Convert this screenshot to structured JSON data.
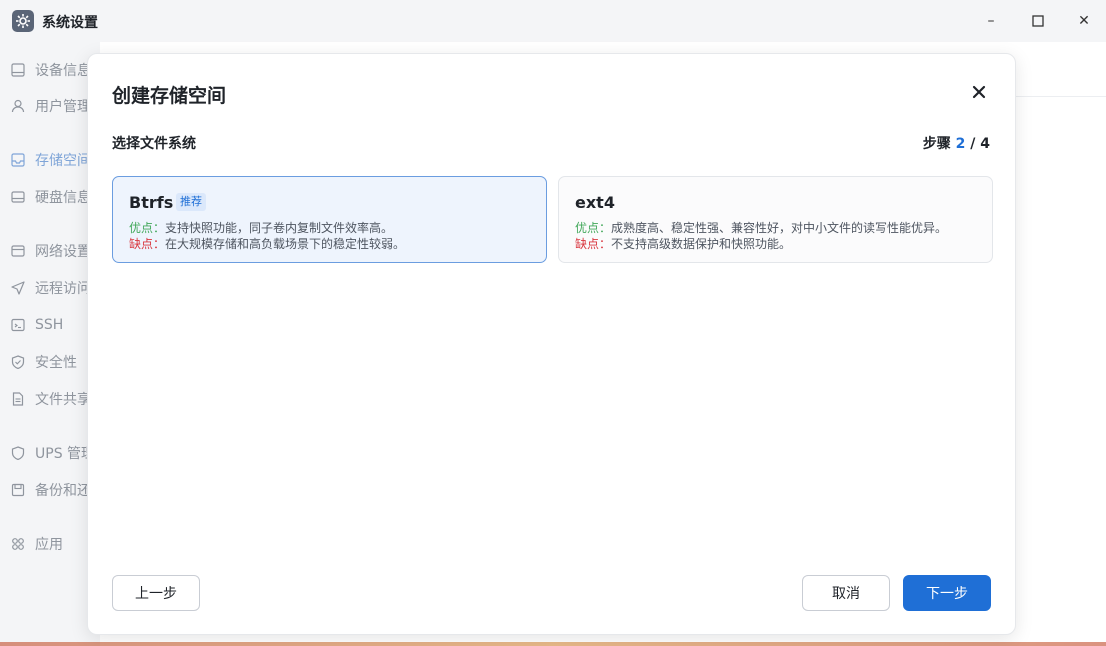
{
  "window": {
    "title": "系统设置",
    "icon": "gear-icon",
    "controls": {
      "minimize": "–",
      "maximize": "☐",
      "close": "✕"
    }
  },
  "sidebar": {
    "items": [
      {
        "label": "设备信息",
        "icon": "device-icon"
      },
      {
        "label": "用户管理",
        "icon": "user-icon"
      },
      {
        "label": "存储空间",
        "icon": "storage-icon",
        "active": true
      },
      {
        "label": "硬盘信息",
        "icon": "disk-icon"
      },
      {
        "label": "网络设置",
        "icon": "network-icon"
      },
      {
        "label": "远程访问",
        "icon": "send-icon"
      },
      {
        "label": "SSH",
        "icon": "terminal-icon"
      },
      {
        "label": "安全性",
        "icon": "shield-icon"
      },
      {
        "label": "文件共享",
        "icon": "document-icon"
      },
      {
        "label": "UPS 管理",
        "icon": "ups-icon"
      },
      {
        "label": "备份和还原",
        "icon": "backup-icon"
      },
      {
        "label": "应用",
        "icon": "apps-icon"
      }
    ]
  },
  "modal": {
    "title": "创建存储空间",
    "section_title": "选择文件系统",
    "step": {
      "prefix": "步骤 ",
      "current": "2",
      "separator": " / ",
      "total": "4"
    },
    "options": [
      {
        "name": "Btrfs",
        "badge": "推荐",
        "pros_label": "优点：",
        "pros": "支持快照功能，同子卷内复制文件效率高。",
        "cons_label": "缺点：",
        "cons": "在大规模存储和高负载场景下的稳定性较弱。",
        "selected": true
      },
      {
        "name": "ext4",
        "pros_label": "优点：",
        "pros": "成熟度高、稳定性强、兼容性好，对中小文件的读写性能优异。",
        "cons_label": "缺点：",
        "cons": "不支持高级数据保护和快照功能。",
        "selected": false
      }
    ],
    "buttons": {
      "prev": "上一步",
      "cancel": "取消",
      "next": "下一步"
    }
  },
  "colors": {
    "accent": "#1f6fd6",
    "pros": "#42a85a",
    "cons": "#d9363e"
  }
}
